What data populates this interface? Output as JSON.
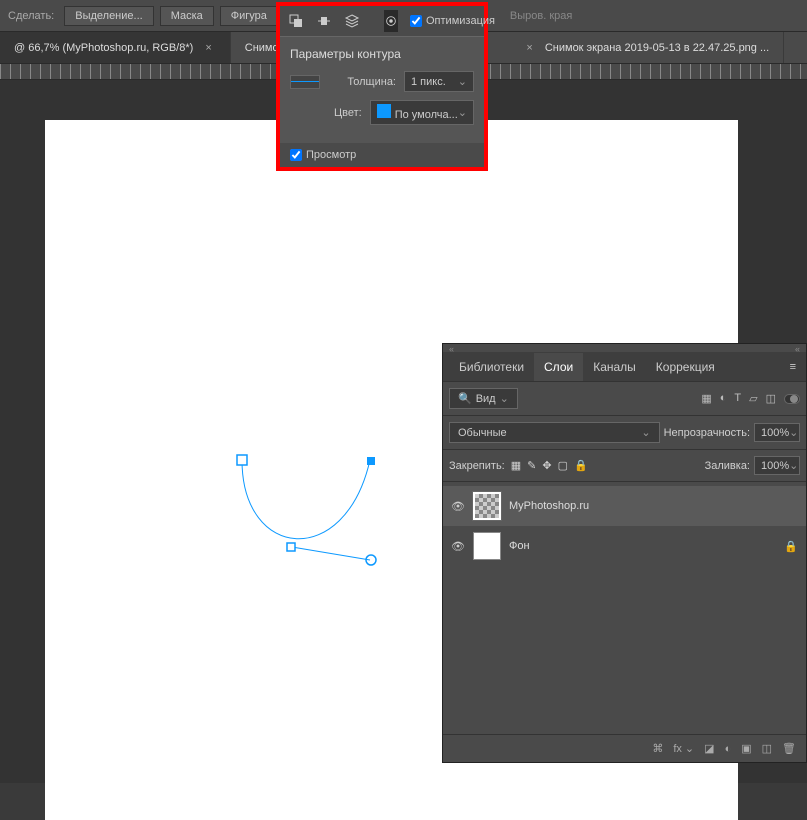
{
  "topbar": {
    "make_label": "Сделать:",
    "selection_btn": "Выделение...",
    "mask_btn": "Маска",
    "shape_btn": "Фигура",
    "optimize_label": "Оптимизация",
    "align_edge_label": "Выров. края"
  },
  "tabs": [
    {
      "label": "@ 66,7% (MyPhotoshop.ru, RGB/8*)"
    },
    {
      "label": "Снимок"
    },
    {
      "label": "Снимок экрана 2019-05-13 в 22.47.25.png ..."
    }
  ],
  "popup": {
    "title": "Параметры контура",
    "thickness_label": "Толщина:",
    "thickness_value": "1 пикс.",
    "color_label": "Цвет:",
    "color_name": "По умолча...",
    "preview_label": "Просмотр"
  },
  "panel": {
    "tabs": {
      "lib": "Библиотеки",
      "layers": "Слои",
      "channels": "Каналы",
      "adj": "Коррекция"
    },
    "filter_type": "Вид",
    "filter_prefix": "Р",
    "blend_mode": "Обычные",
    "opacity_label": "Непрозрачность:",
    "opacity_value": "100%",
    "lock_label": "Закрепить:",
    "fill_label": "Заливка:",
    "fill_value": "100%",
    "layers": [
      {
        "name": "MyPhotoshop.ru",
        "locked": false,
        "active": true
      },
      {
        "name": "Фон",
        "locked": true,
        "active": false
      }
    ]
  }
}
